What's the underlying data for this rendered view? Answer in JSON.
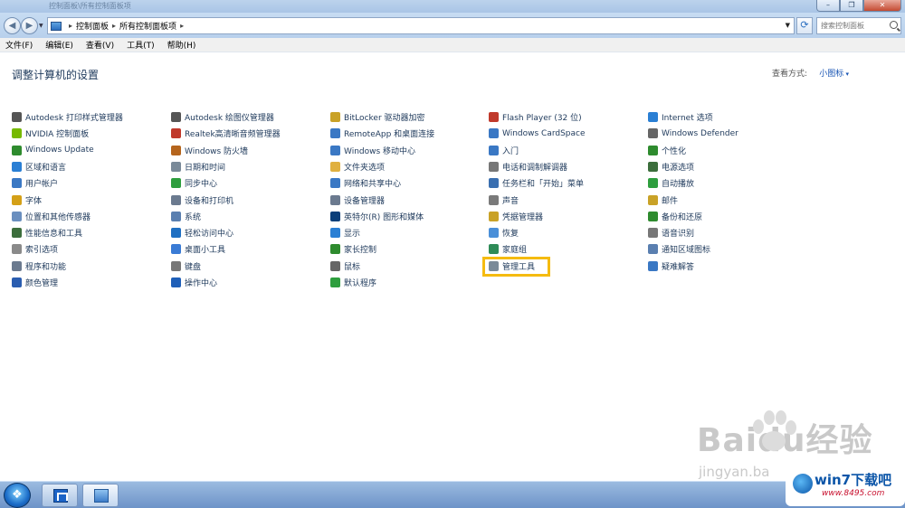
{
  "window": {
    "title": "控制面板\\所有控制面板项"
  },
  "address": {
    "crumbs": [
      "控制面板",
      "所有控制面板项"
    ],
    "search_placeholder": "搜索控制面板"
  },
  "menu": [
    "文件(F)",
    "编辑(E)",
    "查看(V)",
    "工具(T)",
    "帮助(H)"
  ],
  "content": {
    "heading": "调整计算机的设置",
    "viewby_label": "查看方式:",
    "viewby_value": "小图标"
  },
  "columns": [
    [
      {
        "label": "Autodesk 打印样式管理器",
        "icon": "printer-style-icon",
        "color": "#555555"
      },
      {
        "label": "NVIDIA 控制面板",
        "icon": "nvidia-icon",
        "color": "#76b900"
      },
      {
        "label": "Windows Update",
        "icon": "windows-update-icon",
        "color": "#2e8b2e"
      },
      {
        "label": "区域和语言",
        "icon": "globe-icon",
        "color": "#2a7fd4"
      },
      {
        "label": "用户帐户",
        "icon": "user-accounts-icon",
        "color": "#3a78c4"
      },
      {
        "label": "字体",
        "icon": "font-icon",
        "color": "#d4a017"
      },
      {
        "label": "位置和其他传感器",
        "icon": "sensor-icon",
        "color": "#6a8fbf"
      },
      {
        "label": "性能信息和工具",
        "icon": "performance-icon",
        "color": "#3c6e3c"
      },
      {
        "label": "索引选项",
        "icon": "indexing-icon",
        "color": "#8a8a8a"
      },
      {
        "label": "程序和功能",
        "icon": "programs-icon",
        "color": "#6b7a8f"
      },
      {
        "label": "颜色管理",
        "icon": "color-management-icon",
        "color": "#2a5db0"
      }
    ],
    [
      {
        "label": "Autodesk 绘图仪管理器",
        "icon": "plotter-icon",
        "color": "#555555"
      },
      {
        "label": "Realtek高清晰音频管理器",
        "icon": "realtek-audio-icon",
        "color": "#c0392b"
      },
      {
        "label": "Windows 防火墙",
        "icon": "firewall-icon",
        "color": "#b5651d"
      },
      {
        "label": "日期和时间",
        "icon": "clock-icon",
        "color": "#7a8a99"
      },
      {
        "label": "同步中心",
        "icon": "sync-icon",
        "color": "#2e9e3e"
      },
      {
        "label": "设备和打印机",
        "icon": "devices-printers-icon",
        "color": "#6b7a8f"
      },
      {
        "label": "系统",
        "icon": "system-icon",
        "color": "#5a7fb0"
      },
      {
        "label": "轻松访问中心",
        "icon": "ease-of-access-icon",
        "color": "#1f6fc2"
      },
      {
        "label": "桌面小工具",
        "icon": "gadgets-icon",
        "color": "#3a7bd5"
      },
      {
        "label": "键盘",
        "icon": "keyboard-icon",
        "color": "#777777"
      },
      {
        "label": "操作中心",
        "icon": "action-center-icon",
        "color": "#1f5fb8"
      }
    ],
    [
      {
        "label": "BitLocker 驱动器加密",
        "icon": "bitlocker-icon",
        "color": "#c9a227"
      },
      {
        "label": "RemoteApp 和桌面连接",
        "icon": "remoteapp-icon",
        "color": "#3a78c4"
      },
      {
        "label": "Windows 移动中心",
        "icon": "mobility-center-icon",
        "color": "#3a78c4"
      },
      {
        "label": "文件夹选项",
        "icon": "folder-options-icon",
        "color": "#e0b040"
      },
      {
        "label": "网络和共享中心",
        "icon": "network-icon",
        "color": "#3a78c4"
      },
      {
        "label": "设备管理器",
        "icon": "device-manager-icon",
        "color": "#6b7a8f"
      },
      {
        "label": "英特尔(R) 图形和媒体",
        "icon": "intel-graphics-icon",
        "color": "#0b3f7a"
      },
      {
        "label": "显示",
        "icon": "display-icon",
        "color": "#2a7fd4"
      },
      {
        "label": "家长控制",
        "icon": "parental-controls-icon",
        "color": "#2e8b2e"
      },
      {
        "label": "鼠标",
        "icon": "mouse-icon",
        "color": "#666666"
      },
      {
        "label": "默认程序",
        "icon": "default-programs-icon",
        "color": "#2e9e3e"
      }
    ],
    [
      {
        "label": "Flash Player (32 位)",
        "icon": "flash-icon",
        "color": "#c0392b"
      },
      {
        "label": "Windows CardSpace",
        "icon": "cardspace-icon",
        "color": "#3a78c4"
      },
      {
        "label": "入门",
        "icon": "getting-started-icon",
        "color": "#3a78c4"
      },
      {
        "label": "电话和调制解调器",
        "icon": "phone-modem-icon",
        "color": "#777777"
      },
      {
        "label": "任务栏和「开始」菜单",
        "icon": "taskbar-icon",
        "color": "#3a6fb0"
      },
      {
        "label": "声音",
        "icon": "sound-icon",
        "color": "#7a7a7a"
      },
      {
        "label": "凭据管理器",
        "icon": "credential-manager-icon",
        "color": "#c9a227"
      },
      {
        "label": "恢复",
        "icon": "recovery-icon",
        "color": "#4a8fd8"
      },
      {
        "label": "家庭组",
        "icon": "homegroup-icon",
        "color": "#2e8b57"
      },
      {
        "label": "管理工具",
        "icon": "admin-tools-icon",
        "color": "#7a8a99"
      }
    ],
    [
      {
        "label": "Internet 选项",
        "icon": "internet-options-icon",
        "color": "#2a7fd4"
      },
      {
        "label": "Windows Defender",
        "icon": "defender-icon",
        "color": "#666666"
      },
      {
        "label": "个性化",
        "icon": "personalization-icon",
        "color": "#2e8b2e"
      },
      {
        "label": "电源选项",
        "icon": "power-options-icon",
        "color": "#3c6e3c"
      },
      {
        "label": "自动播放",
        "icon": "autoplay-icon",
        "color": "#2e9e3e"
      },
      {
        "label": "邮件",
        "icon": "mail-icon",
        "color": "#c9a227"
      },
      {
        "label": "备份和还原",
        "icon": "backup-icon",
        "color": "#2e8b2e"
      },
      {
        "label": "语音识别",
        "icon": "speech-icon",
        "color": "#777777"
      },
      {
        "label": "通知区域图标",
        "icon": "notification-icons-icon",
        "color": "#5a7fb0"
      },
      {
        "label": "疑难解答",
        "icon": "troubleshooting-icon",
        "color": "#3a78c4"
      }
    ]
  ],
  "watermark": {
    "baidu": "Baidu经验",
    "jingyan": "jingyan.ba",
    "win7_title": "win7下载吧",
    "win7_url": "www.8495.com"
  }
}
